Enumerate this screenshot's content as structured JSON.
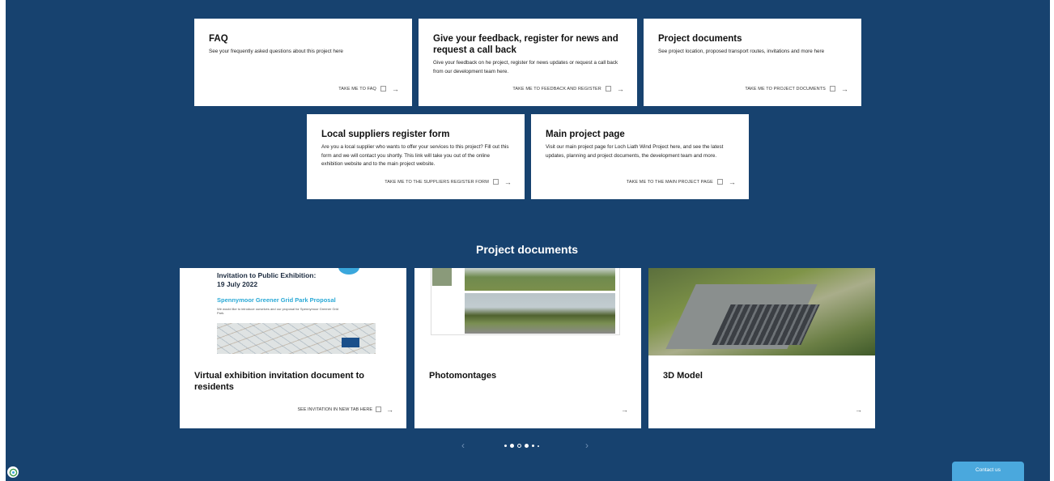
{
  "cards_top": [
    {
      "title": "FAQ",
      "body": "See your frequently asked questions about this project here",
      "link": "TAKE ME TO FAQ"
    },
    {
      "title": "Give your feedback, register for news and request a call back",
      "body": "Give your feedback on he project, register for news updates or request a call back from our development team here.",
      "link": "TAKE ME TO FEEDBACK AND REGISTER"
    },
    {
      "title": "Project documents",
      "body": "See project location, proposed transport routes, invitations and more here",
      "link": "TAKE ME TO PROJECT DOCUMENTS"
    }
  ],
  "cards_bottom": [
    {
      "title": "Local suppliers register form",
      "body": "Are you a local supplier who wants to offer your services to this project? Fill out this form and we will contact you shortly. This link will take you out of the online exhibition website and to the main project website.",
      "link": "TAKE ME TO THE SUPPLIERS REGISTER FORM"
    },
    {
      "title": "Main project page",
      "body": "Visit our main project page for Loch Liath Wind Project here, and see the latest updates, planning and project documents, the development team and more.",
      "link": "TAKE ME TO THE MAIN PROJECT PAGE"
    }
  ],
  "section_title": "Project documents",
  "documents": [
    {
      "title": "Virtual exhibition invitation document to residents",
      "link": "SEE INVITATION IN NEW TAB HERE",
      "thumb": {
        "heading_line1": "Invitation to Public Exhibition:",
        "heading_line2": "19 July 2022",
        "subheading": "Spennymoor Greener Grid Park Proposal",
        "text": "We would like to introduce ourselves and our proposal for Spennymoor Greener Grid Park."
      }
    },
    {
      "title": "Photomontages",
      "link": ""
    },
    {
      "title": "3D Model",
      "link": ""
    }
  ],
  "pager": {
    "prev": "‹",
    "next": "›"
  },
  "contact": "Contact us",
  "colors": {
    "background": "#17426f",
    "accent": "#4aa8dd"
  },
  "icons": {
    "external": "external-link-icon",
    "arrow": "arrow-right-icon",
    "logo": "site-logo-icon"
  }
}
